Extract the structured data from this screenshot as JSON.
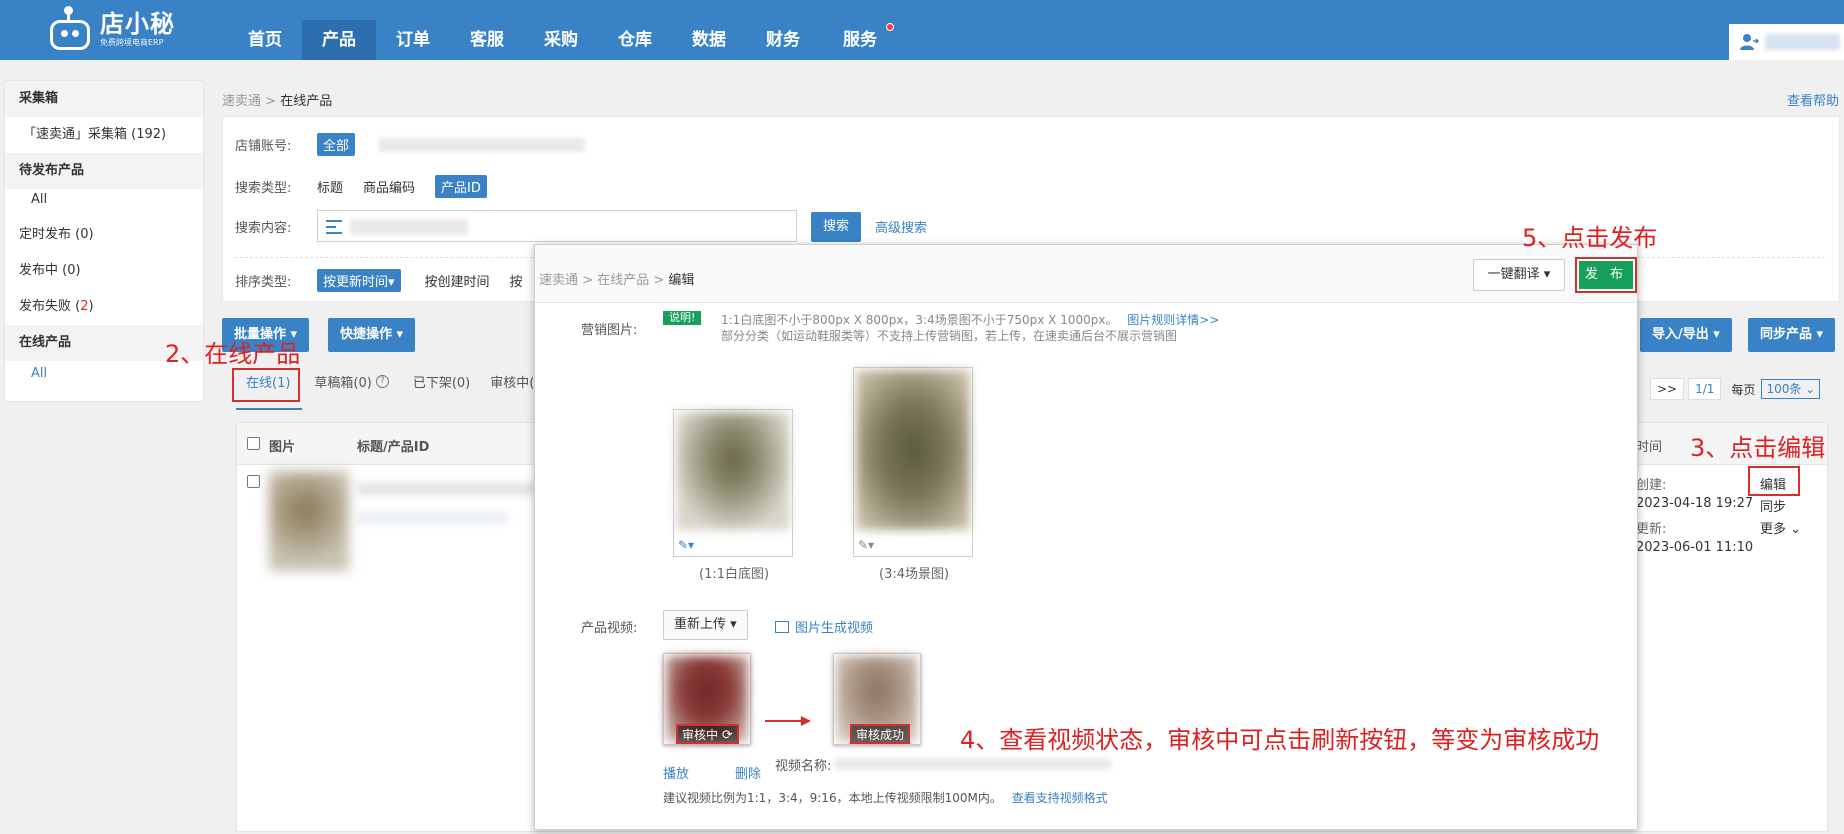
{
  "app": {
    "logo_title": "店小秘",
    "logo_subtitle": "免费跨境电商ERP"
  },
  "nav": {
    "items": [
      "首页",
      "产品",
      "订单",
      "客服",
      "采购",
      "仓库",
      "数据",
      "财务",
      "服务"
    ],
    "active": "产品"
  },
  "sidebar": {
    "section1": "采集箱",
    "collect_item": "「速卖通」采集箱 (192)",
    "section2": "待发布产品",
    "all1": "All",
    "scheduled": "定时发布 (0)",
    "publishing": "发布中 (0)",
    "failed_label": "发布失败 (",
    "failed_count": "2",
    "failed_close": ")",
    "section3": "在线产品",
    "all2": "All"
  },
  "breadcrumb": {
    "root": "速卖通",
    "current": "在线产品"
  },
  "help_link": "查看帮助",
  "filters": {
    "shop_label": "店铺账号:",
    "shop_all": "全部",
    "search_type_label": "搜索类型:",
    "type_title": "标题",
    "type_code": "商品编码",
    "type_id": "产品ID",
    "content_label": "搜索内容:",
    "search_btn": "搜索",
    "advanced": "高级搜索",
    "sort_label": "排序类型:",
    "sort_update": "按更新时间▾",
    "sort_create": "按创建时间",
    "sort_more": "按"
  },
  "toolbar": {
    "batch": "批量操作 ▾",
    "quick": "快捷操作 ▾",
    "import_export": "导入/导出 ▾",
    "sync": "同步产品 ▾"
  },
  "tabs": [
    "在线(1)",
    "草稿箱(0)",
    "已下架(0)",
    "审核中("
  ],
  "tab_help_icon": "?",
  "pagination": {
    "next": ">>",
    "page": "1/1",
    "per_page_label": "每页",
    "per_page": "100条"
  },
  "table": {
    "col_image": "图片",
    "col_title": "标题/产品ID",
    "col_time": "时间"
  },
  "row": {
    "created_label": "创建:",
    "created": "2023-04-18 19:27",
    "updated_label": "更新:",
    "updated": "2023-06-01 11:10",
    "edit": "编辑",
    "sync": "同步",
    "more": "更多"
  },
  "dialog": {
    "bc_root": "速卖通",
    "bc_mid": "在线产品",
    "bc_current": "编辑",
    "translate_btn": "一键翻译 ▾",
    "publish_btn": "发 布",
    "marketing_label": "营销图片:",
    "note_tag": "说明!",
    "note_line1": "1:1白底图不小于800px X 800px，3:4场景图不小于750px X 1000px。",
    "rules_link": "图片规则详情>>",
    "note_line2": "部分分类（如运动鞋服类等）不支持上传营销图，若上传，在速卖通后台不展示营销图",
    "caption_square": "(1:1白底图)",
    "caption_scene": "(3:4场景图)",
    "video_label": "产品视频:",
    "reupload": "重新上传 ▾",
    "img_to_video": "图片生成视频",
    "status_reviewing": "审核中",
    "status_success": "审核成功",
    "play": "播放",
    "delete": "删除",
    "video_name_label": "视频名称:",
    "video_tip": "建议视频比例为1:1，3:4，9:16，本地上传视频限制100M内。",
    "video_format_link": "查看支持视频格式"
  },
  "annotations": {
    "step2": "2、在线产品",
    "step3": "3、点击编辑",
    "step4": "4、查看视频状态，审核中可点击刷新按钮，等变为审核成功",
    "step5": "5、点击发布"
  },
  "colors": {
    "brand": "#3a82c6",
    "publish": "#17a05b",
    "annotation": "#e02020"
  }
}
